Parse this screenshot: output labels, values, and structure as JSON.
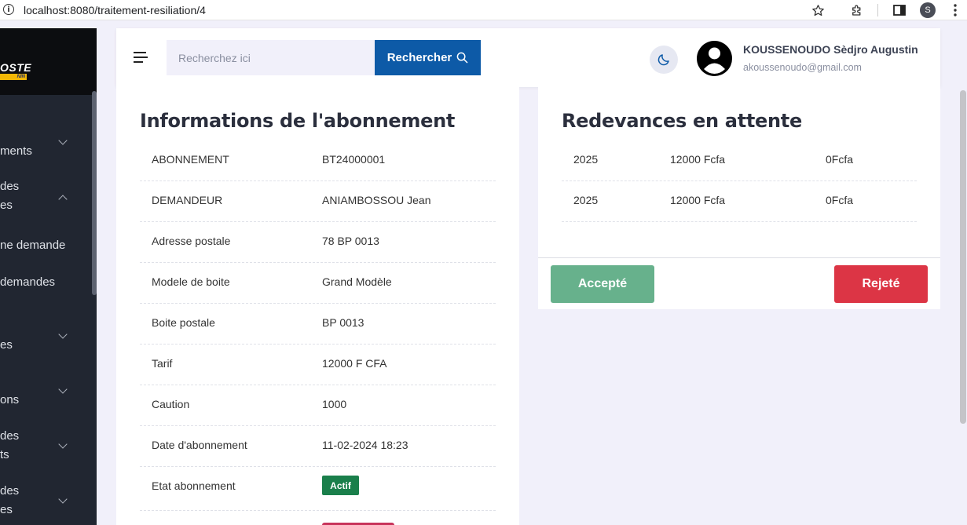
{
  "browser": {
    "url": "localhost:8080/traitement-resiliation/4",
    "profile_initial": "S"
  },
  "sidebar": {
    "logo_text": "OSTE",
    "logo_band_text": "NIN",
    "items": [
      {
        "label": "ments",
        "chevron": "down"
      },
      {
        "label": "des",
        "label2": "es",
        "chevron": "up"
      },
      {
        "label": "ne demande"
      },
      {
        "label": "demandes"
      },
      {
        "label": "es",
        "chevron": "down"
      },
      {
        "label": "ons",
        "chevron": "down"
      },
      {
        "label": "des",
        "label2": "ts",
        "chevron": "down"
      },
      {
        "label": "des",
        "label2": "es",
        "chevron": "down"
      }
    ]
  },
  "header": {
    "search_placeholder": "Recherchez ici",
    "search_button": "Rechercher",
    "user_name": "KOUSSENOUDO Sèdjro Augustin",
    "user_email": "akoussenoudo@gmail.com"
  },
  "subscription": {
    "title": "Informations de l'abonnement",
    "rows": [
      {
        "label": "ABONNEMENT",
        "value": "BT24000001"
      },
      {
        "label": "DEMANDEUR",
        "value": "ANIAMBOSSOU Jean"
      },
      {
        "label": "Adresse postale",
        "value": "78 BP 0013"
      },
      {
        "label": "Modele de boite",
        "value": "Grand Modèle"
      },
      {
        "label": "Boite postale",
        "value": "BP 0013"
      },
      {
        "label": "Tarif",
        "value": "12000 F CFA"
      },
      {
        "label": "Caution",
        "value": "1000"
      },
      {
        "label": "Date d'abonnement",
        "value": "11-02-2024 18:23"
      },
      {
        "label": "Etat abonnement",
        "badge": "Actif"
      }
    ]
  },
  "redevances": {
    "title": "Redevances en attente",
    "rows": [
      {
        "year": "2025",
        "amount": "12000 Fcfa",
        "paid": "0Fcfa"
      },
      {
        "year": "2025",
        "amount": "12000 Fcfa",
        "paid": "0Fcfa"
      }
    ],
    "accept_label": "Accepté",
    "reject_label": "Rejeté"
  },
  "colors": {
    "primary": "#0d5aa7",
    "success": "#67b18c",
    "danger": "#dc3545",
    "badge_active": "#1a7f4b",
    "sidebar_bg": "#212631"
  }
}
